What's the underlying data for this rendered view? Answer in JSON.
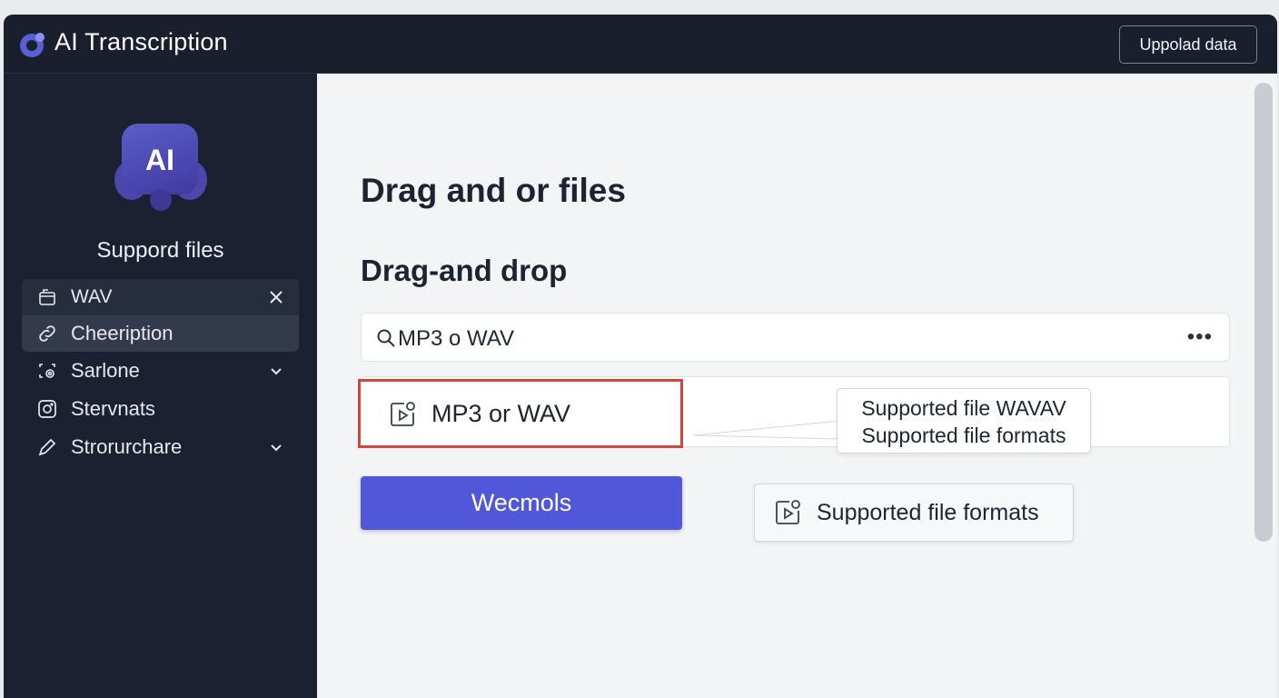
{
  "app": {
    "title": "AI Transcription",
    "upload_button": "Uppolad data",
    "accent": "#5157d9",
    "titlebar_color": "#1a1f2e",
    "sidebar_color": "#1b2130"
  },
  "sidebar": {
    "badge_text": "AI",
    "heading": "Suppord files",
    "items": [
      {
        "label": "WAV",
        "icon": "file-tray-icon",
        "trailing": "close-icon"
      },
      {
        "label": "Cheeription",
        "icon": "link-icon",
        "trailing": ""
      },
      {
        "label": "Sarlone",
        "icon": "settings-panel-icon",
        "trailing": "chevron-down-icon"
      },
      {
        "label": "Stervnats",
        "icon": "instagram-icon",
        "trailing": ""
      },
      {
        "label": "Strorurchare",
        "icon": "pen-icon",
        "trailing": "chevron-down-icon"
      }
    ]
  },
  "main": {
    "heading": "Drag and or files",
    "subheading": "Drag-and drop",
    "search": {
      "value": "MP3 o WAV",
      "more": "•••"
    },
    "file_item": {
      "label": "MP3 or WAV",
      "icon": "media-file-icon",
      "highlight": "#d6453a"
    },
    "tooltip": {
      "line1": "Supported file WAVAV",
      "line2": "Supported file formats"
    },
    "primary_button": "Wecmols",
    "chip": {
      "label": "Supported file formats",
      "icon": "media-file-icon"
    }
  }
}
